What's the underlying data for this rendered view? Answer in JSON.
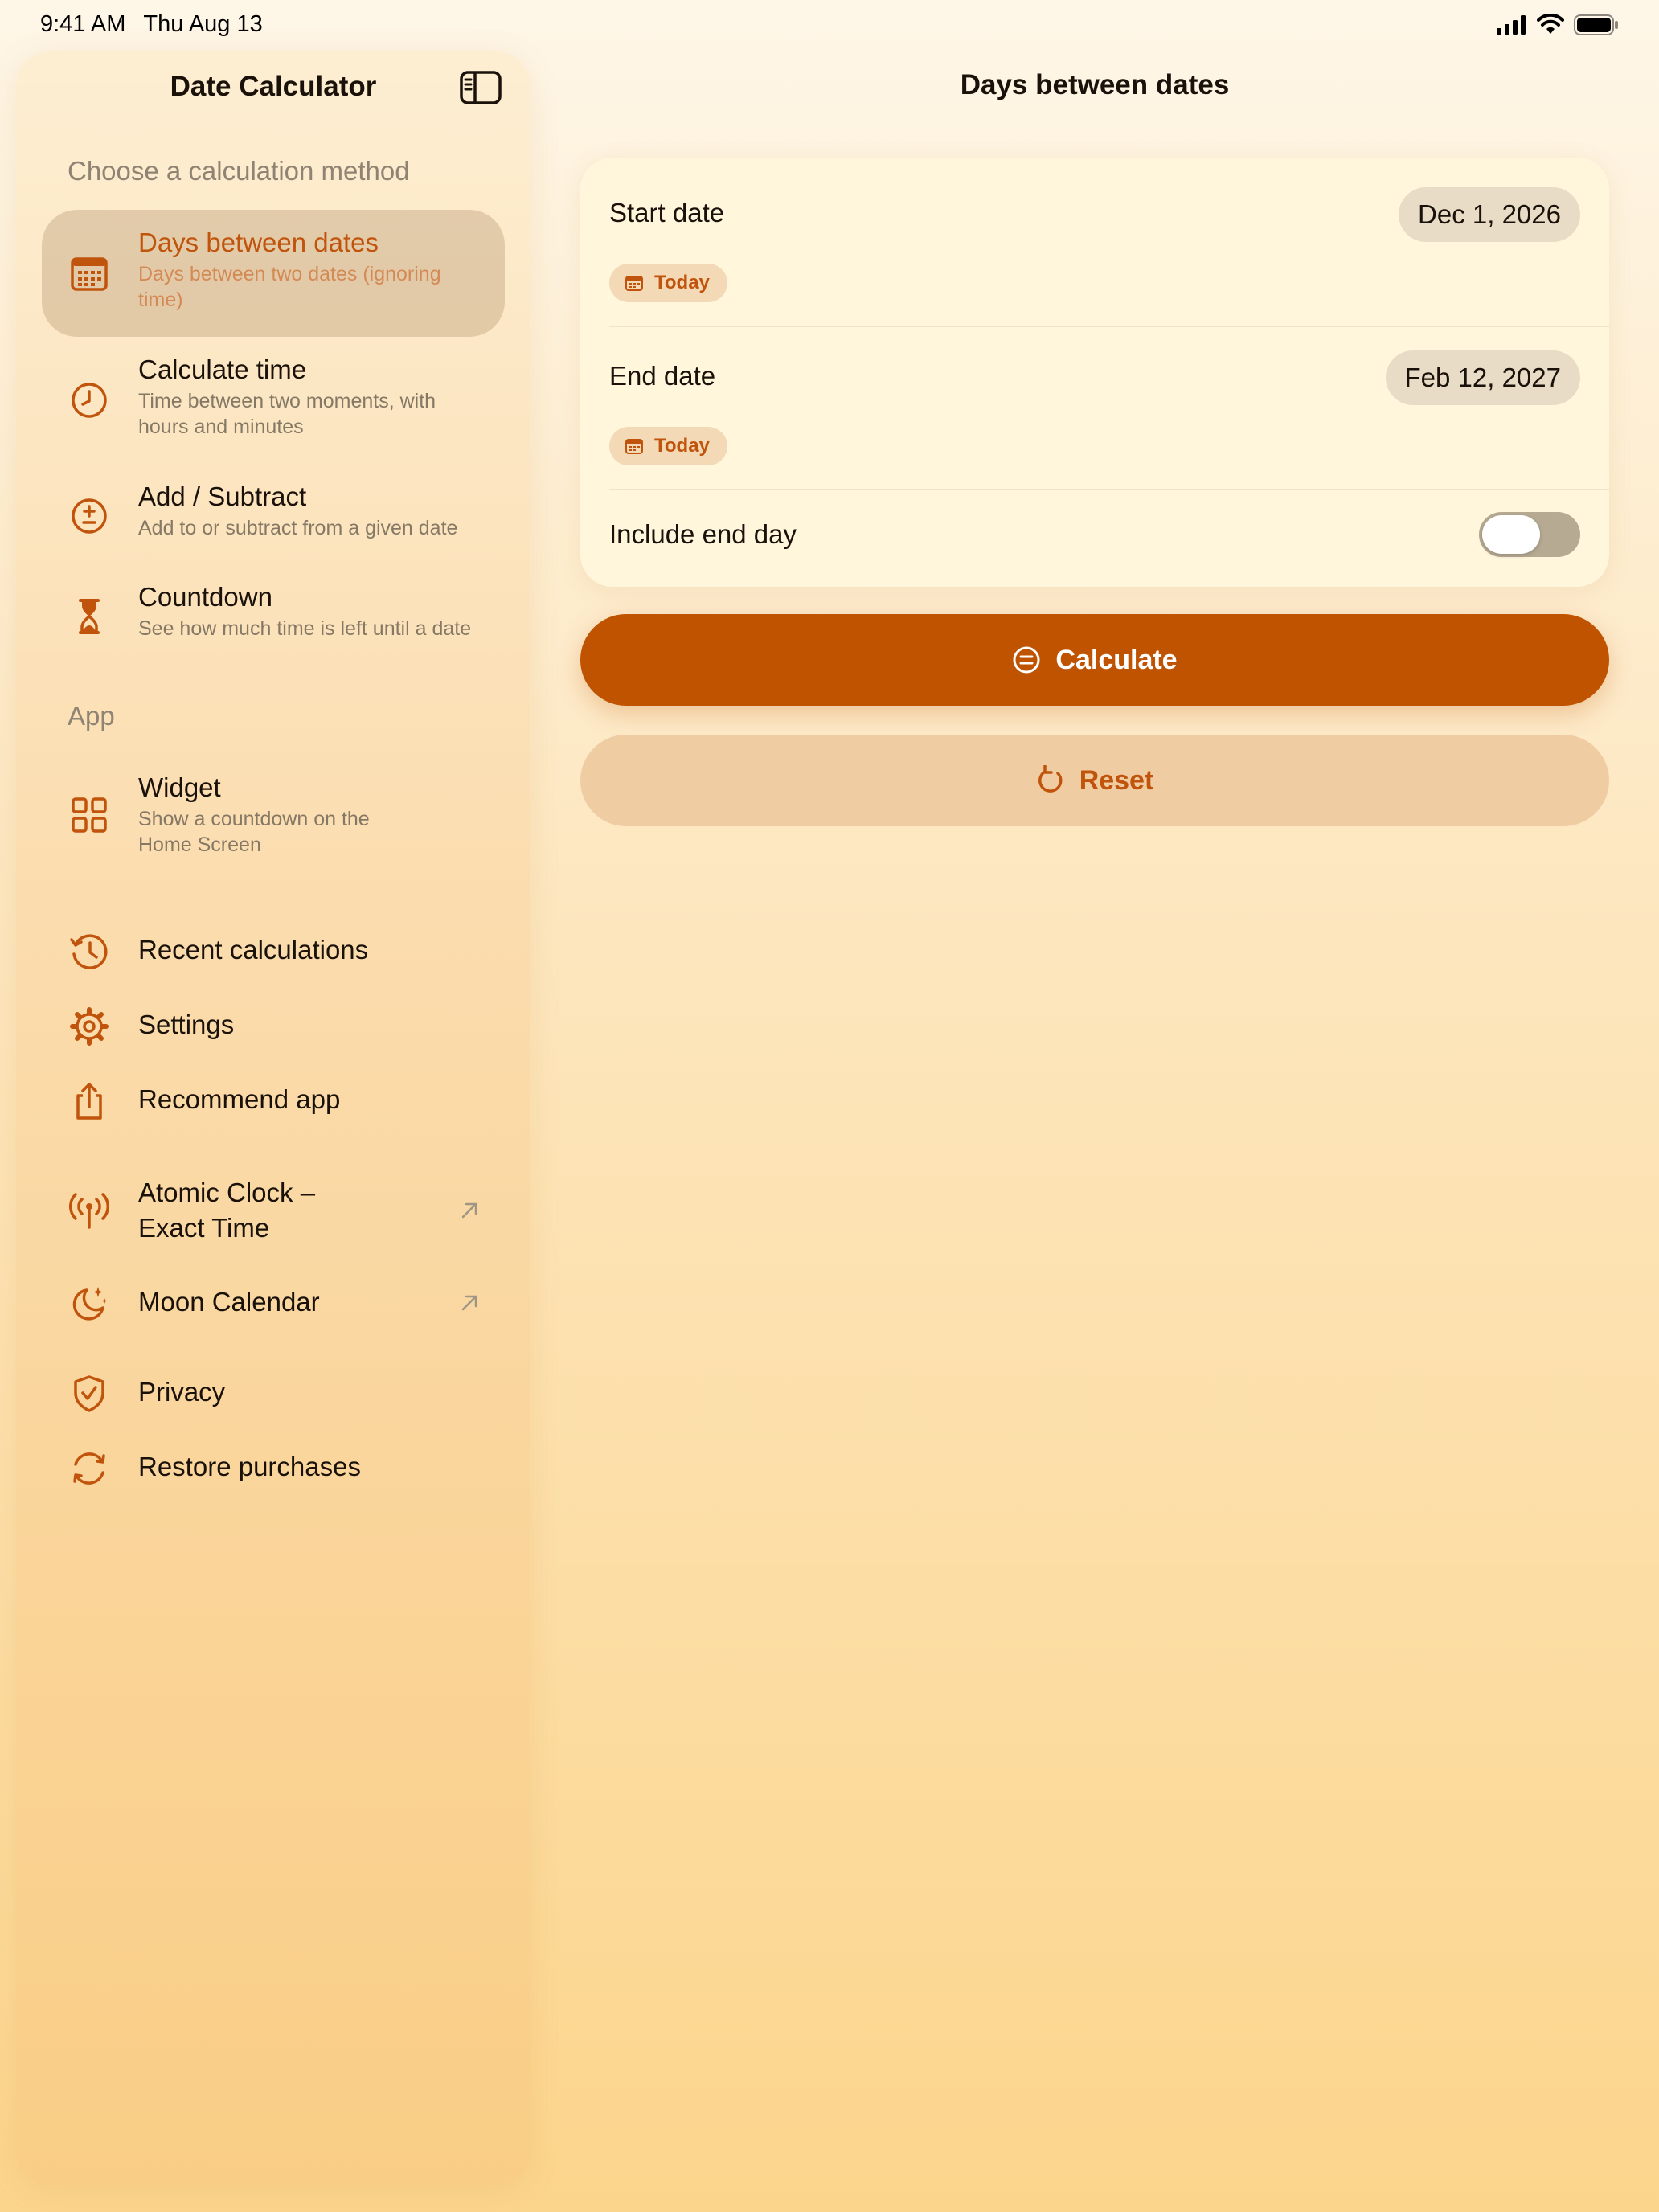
{
  "status_bar": {
    "time": "9:41 AM",
    "date": "Thu Aug 13"
  },
  "sidebar": {
    "title": "Date Calculator",
    "methods_header": "Choose a calculation method",
    "methods": [
      {
        "title": "Days between dates",
        "subtitle": "Days between two dates (ignoring time)",
        "icon": "calendar-icon",
        "selected": true
      },
      {
        "title": "Calculate time",
        "subtitle": "Time between two moments, with hours and minutes",
        "icon": "clock-icon"
      },
      {
        "title": "Add / Subtract",
        "subtitle": "Add to or subtract from a given date",
        "icon": "plus-minus-icon"
      },
      {
        "title": "Countdown",
        "subtitle": "See how much time is left until a date",
        "icon": "hourglass-icon"
      }
    ],
    "app_header": "App",
    "app_items": [
      {
        "title": "Widget",
        "subtitle": "Show a countdown on the Home Screen",
        "icon": "widget-grid-icon"
      },
      {
        "title": "Recent calculations",
        "icon": "history-icon"
      },
      {
        "title": "Settings",
        "icon": "gear-icon"
      },
      {
        "title": "Recommend app",
        "icon": "share-icon"
      },
      {
        "title": "Atomic Clock –\nExact Time",
        "icon": "antenna-icon",
        "external": true
      },
      {
        "title": "Moon Calendar",
        "icon": "moon-stars-icon",
        "external": true
      },
      {
        "title": "Privacy",
        "icon": "shield-check-icon"
      },
      {
        "title": "Restore purchases",
        "icon": "restore-icon"
      }
    ]
  },
  "main": {
    "title": "Days between dates",
    "start_label": "Start date",
    "start_value": "Dec 1, 2026",
    "end_label": "End date",
    "end_value": "Feb 12, 2027",
    "today_label": "Today",
    "include_end_label": "Include end day",
    "include_end_on": false,
    "calculate_label": "Calculate",
    "reset_label": "Reset"
  },
  "colors": {
    "accent": "#c05300",
    "accent_text": "#c0540c",
    "secondary_button": "#f0cca3"
  }
}
